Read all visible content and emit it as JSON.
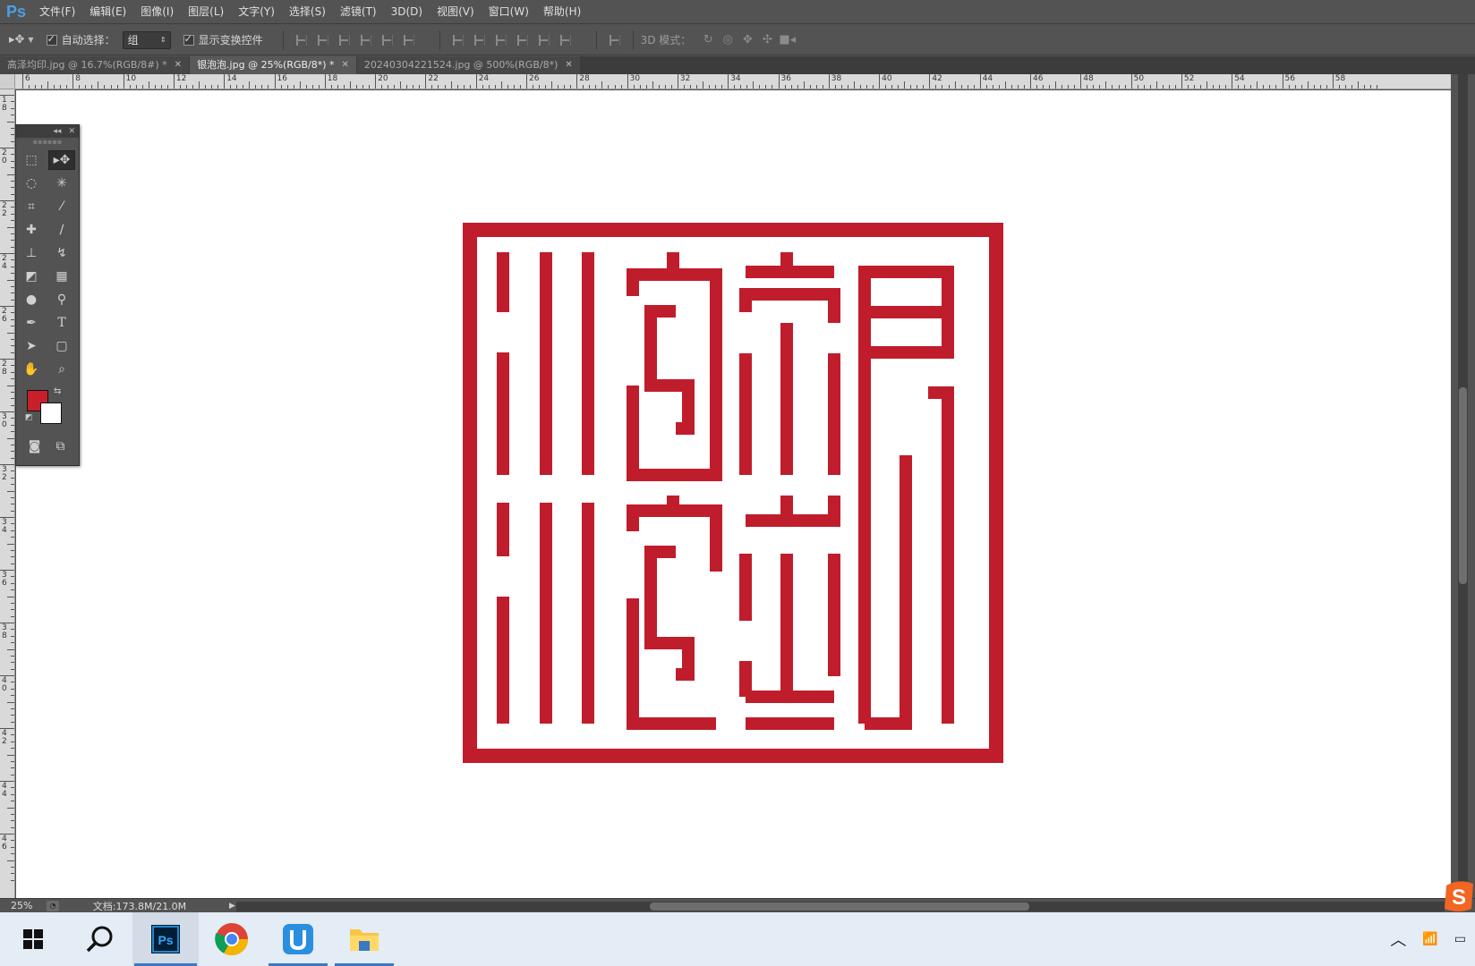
{
  "app": {
    "logo": "Ps"
  },
  "menu": [
    "文件(F)",
    "编辑(E)",
    "图像(I)",
    "图层(L)",
    "文字(Y)",
    "选择(S)",
    "滤镜(T)",
    "3D(D)",
    "视图(V)",
    "窗口(W)",
    "帮助(H)"
  ],
  "options": {
    "auto_select_label": "自动选择：",
    "auto_select_checked": true,
    "auto_select_value": "组",
    "show_transform_label": "显示变换控件",
    "show_transform_checked": true,
    "mode_3d_label": "3D 模式："
  },
  "tabs": [
    {
      "label": "高泽均印.jpg @ 16.7%(RGB/8#) *",
      "active": false
    },
    {
      "label": "银泡泡.jpg @ 25%(RGB/8*) *",
      "active": true
    },
    {
      "label": "20240304221524.jpg @ 500%(RGB/8*)",
      "active": false
    }
  ],
  "ruler_top": [
    "6",
    "8",
    "10",
    "12",
    "14",
    "16",
    "18",
    "20",
    "22",
    "24",
    "26",
    "28",
    "30",
    "32",
    "34",
    "36",
    "38",
    "40",
    "42",
    "44",
    "46",
    "48",
    "50",
    "52",
    "54",
    "56",
    "58"
  ],
  "ruler_left": [
    "18",
    "20",
    "22",
    "24",
    "26",
    "28",
    "30",
    "32",
    "34",
    "36",
    "38",
    "40",
    "42",
    "44",
    "46"
  ],
  "colors": {
    "foreground": "#c8202b",
    "background": "#ffffff",
    "seal": "#c01d2c"
  },
  "tools": [
    "rectangular-marquee",
    "move",
    "lasso",
    "magic-wand",
    "crop",
    "eyedropper",
    "spot-healing",
    "brush",
    "clone-stamp",
    "history-brush",
    "eraser",
    "gradient",
    "blur",
    "dodge",
    "pen",
    "type",
    "path-selection",
    "rectangle",
    "hand",
    "zoom"
  ],
  "status": {
    "zoom": "25%",
    "doc_info": "文档:173.8M/21.0M"
  },
  "taskbar": [
    "windows-start",
    "search",
    "photoshop",
    "chrome",
    "app-u",
    "file-explorer"
  ]
}
